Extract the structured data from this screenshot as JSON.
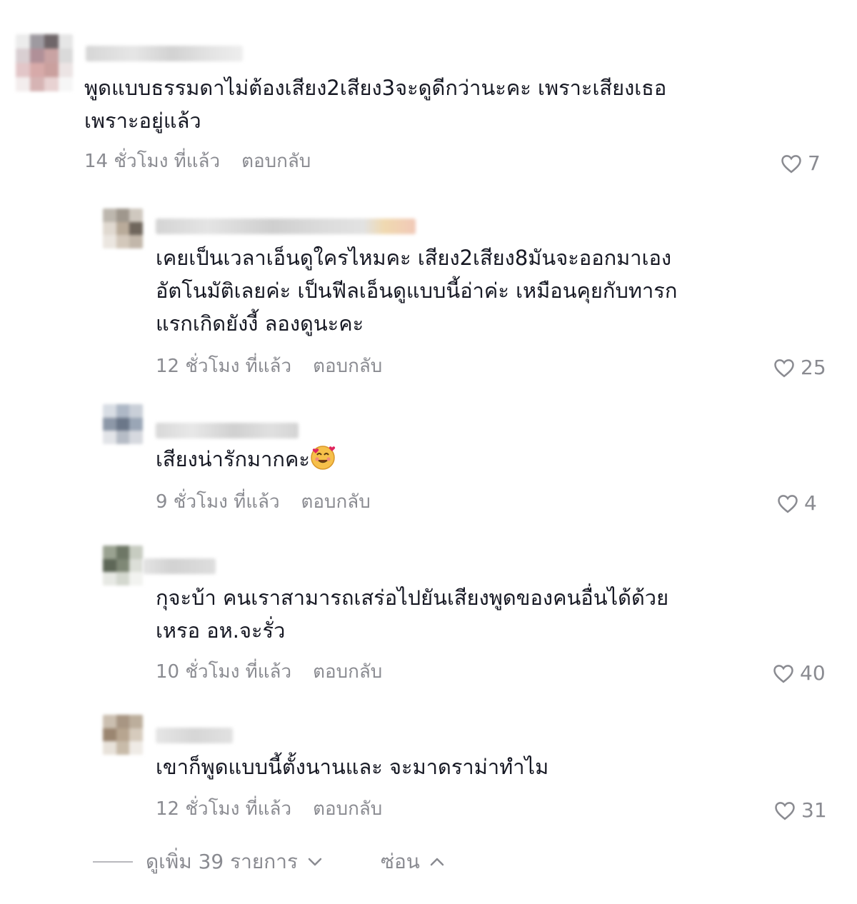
{
  "comments": [
    {
      "text": "พูดแบบธรรมดาไม่ต้องเสียง2เสียง3จะดูดีกว่านะคะ เพราะเสียงเธอ\nเพราะอยู่แล้ว",
      "time": "14 ชั่วโมง ที่แล้ว",
      "reply_label": "ตอบกลับ",
      "likes": "7"
    },
    {
      "text": "เคยเป็นเวลาเอ็นดูใครไหมคะ เสียง2เสียง8มันจะออกมาเอง\nอัตโนมัติเลยค่ะ เป็นฟีลเอ็นดูแบบนี้อ่าค่ะ เหมือนคุยกับทารก\nแรกเกิดยังงี้ ลองดูนะคะ",
      "time": "12 ชั่วโมง ที่แล้ว",
      "reply_label": "ตอบกลับ",
      "likes": "25"
    },
    {
      "text": "เสียงน่ารักมากคะ",
      "emoji": "smiling-face-with-hearts",
      "time": "9 ชั่วโมง ที่แล้ว",
      "reply_label": "ตอบกลับ",
      "likes": "4"
    },
    {
      "text": "กุจะบ้า คนเราสามารถเสร่อไปยันเสียงพูดของคนอื่นได้ด้วย\nเหรอ อห.จะรั่ว",
      "time": "10 ชั่วโมง ที่แล้ว",
      "reply_label": "ตอบกลับ",
      "likes": "40"
    },
    {
      "text": "เขาก็พูดแบบนี้ตั้งนานและ จะมาดราม่าทำไม",
      "time": "12 ชั่วโมง ที่แล้ว",
      "reply_label": "ตอบกลับ",
      "likes": "31"
    }
  ],
  "footer": {
    "view_more": "ดูเพิ่ม 39 รายการ",
    "hide": "ซ่อน"
  },
  "icons": {
    "like": "heart-outline-icon",
    "expand": "chevron-down-icon",
    "collapse": "chevron-up-icon"
  },
  "colors": {
    "text": "#161823",
    "muted": "#8a8b91"
  }
}
